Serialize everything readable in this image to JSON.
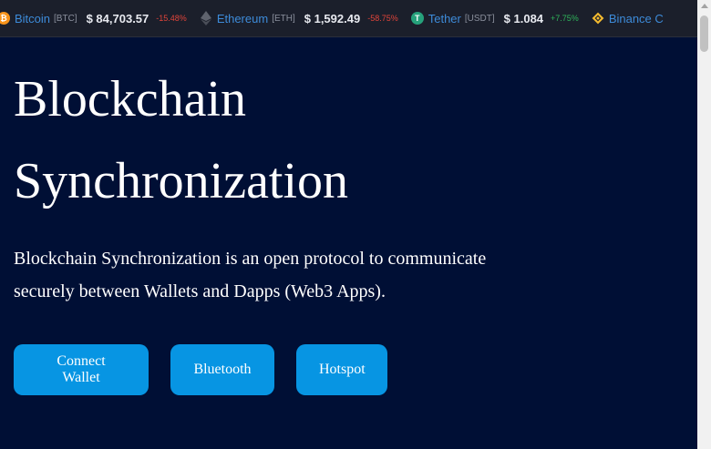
{
  "ticker": {
    "coins": [
      {
        "name": "Bitcoin",
        "symbol": "[BTC]",
        "price": "$ 84,703.57",
        "change": "-15.48%",
        "direction": "down",
        "icon": "bitcoin-icon",
        "color": "#f7931a"
      },
      {
        "name": "Ethereum",
        "symbol": "[ETH]",
        "price": "$ 1,592.49",
        "change": "-58.75%",
        "direction": "down",
        "icon": "ethereum-icon",
        "color": "#5f636e"
      },
      {
        "name": "Tether",
        "symbol": "[USDT]",
        "price": "$ 1.084",
        "change": "+7.75%",
        "direction": "up",
        "icon": "tether-icon",
        "color": "#26a17b"
      },
      {
        "name": "Binance C",
        "icon": "binance-icon",
        "color": "#f3ba2f"
      }
    ]
  },
  "hero": {
    "title": "Blockchain Synchronization",
    "description": "Blockchain Synchronization is an open protocol to communicate securely between Wallets and Dapps (Web3 Apps)."
  },
  "buttons": {
    "connect": "Connect Wallet",
    "bluetooth": "Bluetooth",
    "hotspot": "Hotspot"
  }
}
